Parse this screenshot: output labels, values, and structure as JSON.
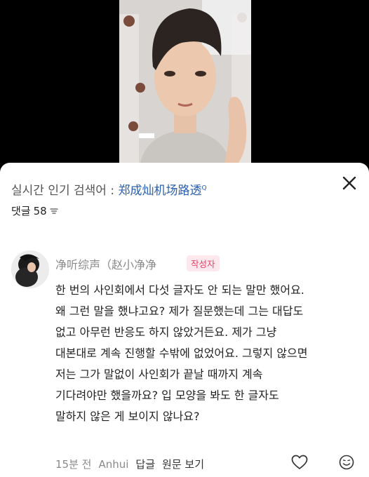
{
  "trending": {
    "prefix": "실시간 인기 검색어 : ",
    "keyword": "郑成灿机场路透",
    "marker": "Q"
  },
  "comments_header": {
    "label": "댓글",
    "count": "58"
  },
  "comment": {
    "author": "净听综声（赵小净净",
    "badge": "작성자",
    "lines": [
      "한 번의 사인회에서 다섯 글자도 안 되는 말만 했어요.",
      "왜 그런 말을 했냐고요? 제가 질문했는데 그는 대답도",
      "없고 아무런 반응도 하지 않았거든요. 제가 그냥",
      "대본대로 계속 진행할 수밖에 없었어요. 그렇지 않으면",
      "저는 그가 말없이 사인회가 끝날 때까지 계속",
      "기다려야만 했을까요? 입 모양을 봐도 한 글자도",
      "말하지 않은 게 보이지 않나요?"
    ],
    "time": "15분 전",
    "location": "Anhui",
    "reply_label": "답글",
    "original_label": "원문 보기"
  },
  "icons": {
    "close": "close-icon",
    "sort": "sort-icon",
    "like": "heart-icon",
    "emoji": "emoji-icon"
  },
  "colors": {
    "keyword": "#2a5fb0",
    "badge_text": "#e0476b",
    "badge_bg": "#fde8ee"
  }
}
